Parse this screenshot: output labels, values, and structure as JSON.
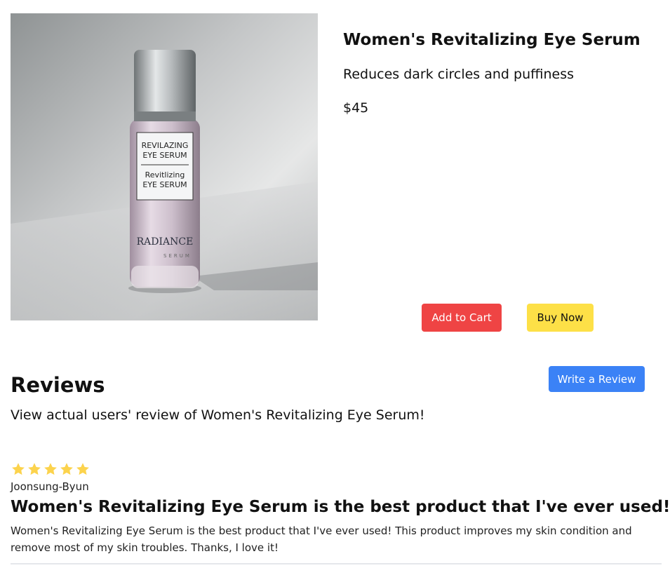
{
  "product": {
    "title": "Women's Revitalizing Eye Serum",
    "subtitle": "Reduces dark circles and puffiness",
    "price": "$45",
    "image": {
      "label_line1": "REVILAZING",
      "label_line2": "EYE SERUM",
      "label_line3": "Revitlizing",
      "label_line4": "EYE SERUM",
      "brand": "RADIANCE",
      "brand_sub": "SERUM"
    },
    "add_to_cart_label": "Add to Cart",
    "buy_now_label": "Buy Now"
  },
  "reviews": {
    "heading": "Reviews",
    "intro": "View actual users' review of Women's Revitalizing Eye Serum!",
    "write_review_label": "Write a Review",
    "items": [
      {
        "rating": 5,
        "author": "Joonsung-Byun",
        "title": "Women's Revitalizing Eye Serum is the best product that I've ever used!",
        "body": "Women's Revitalizing Eye Serum is the best product that I've ever used! This product improves my skin condition and remove most of my skin troubles. Thanks, I love it!"
      }
    ]
  },
  "colors": {
    "add_to_cart": "#ef4444",
    "buy_now": "#fde047",
    "write_review": "#3b82f6",
    "star": "#fcd34d"
  },
  "icons": {
    "rating_star": "star-icon"
  }
}
